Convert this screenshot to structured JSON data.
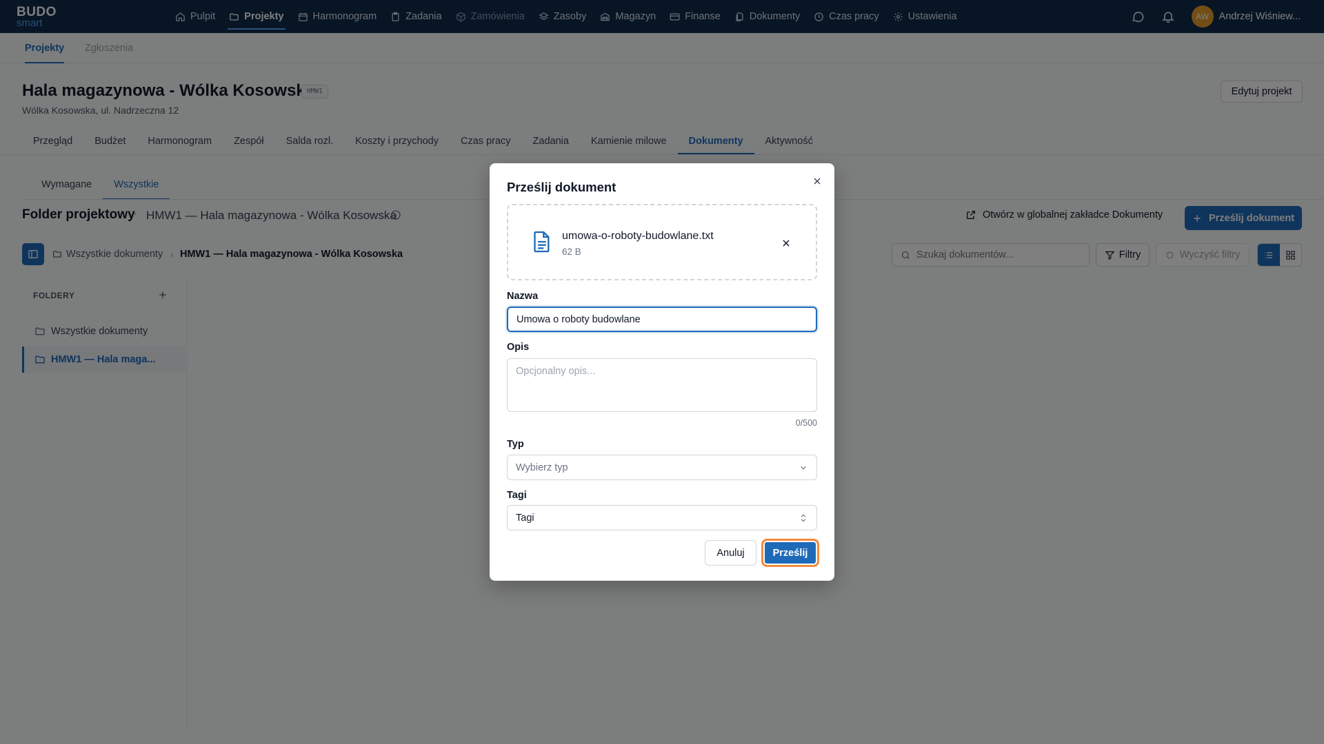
{
  "app": {
    "logo_line1": "BUDO",
    "logo_line2": "smart"
  },
  "nav": {
    "items": [
      {
        "label": "Pulpit",
        "icon": "home-icon"
      },
      {
        "label": "Projekty",
        "icon": "folder-icon"
      },
      {
        "label": "Harmonogram",
        "icon": "calendar-icon"
      },
      {
        "label": "Zadania",
        "icon": "clipboard-icon"
      },
      {
        "label": "Zamówienia",
        "icon": "package-icon"
      },
      {
        "label": "Zasoby",
        "icon": "layers-icon"
      },
      {
        "label": "Magazyn",
        "icon": "warehouse-icon"
      },
      {
        "label": "Finanse",
        "icon": "credit-card-icon"
      },
      {
        "label": "Dokumenty",
        "icon": "files-icon"
      },
      {
        "label": "Czas pracy",
        "icon": "clock-icon"
      },
      {
        "label": "Ustawienia",
        "icon": "gear-icon"
      }
    ],
    "user": {
      "initials": "AW",
      "name": "Andrzej Wiśniew..."
    }
  },
  "subnav": {
    "tabs": [
      "Projekty",
      "Zgłoszenia"
    ]
  },
  "project": {
    "title": "Hala magazynowa - Wólka Kosowska",
    "code": "HMW1",
    "address": "Wólka Kosowska, ul. Nadrzeczna 12",
    "edit_label": "Edytuj projekt",
    "tabs": [
      "Przegląd",
      "Budżet",
      "Harmonogram",
      "Zespół",
      "Salda rozl.",
      "Koszty i przychody",
      "Czas pracy",
      "Zadania",
      "Kamienie milowe",
      "Dokumenty",
      "Aktywność"
    ]
  },
  "documents": {
    "tabs": [
      "Wymagane",
      "Wszystkie"
    ],
    "folder_title": "Folder projektowy",
    "folder_dot": "·",
    "folder_subtitle": "HMW1 — Hala magazynowa - Wólka Kosowska",
    "open_global_label": "Otwórz w globalnej zakładce Dokumenty",
    "upload_label": "Prześlij dokument",
    "breadcrumb_root": "Wszystkie dokumenty",
    "breadcrumb_current": "HMW1 — Hala magazynowa - Wólka Kosowska",
    "search_placeholder": "Szukaj dokumentów...",
    "filters_label": "Filtry",
    "clear_filters_label": "Wyczyść filtry",
    "folders_heading": "FOLDERY",
    "folders": [
      "Wszystkie dokumenty",
      "HMW1 — Hala maga..."
    ]
  },
  "modal": {
    "title": "Prześlij dokument",
    "file_name": "umowa-o-roboty-budowlane.txt",
    "file_size": "62 B",
    "name_label": "Nazwa",
    "name_value": "Umowa o roboty budowlane",
    "description_label": "Opis",
    "description_placeholder": "Opcjonalny opis...",
    "description_counter": "0/500",
    "type_label": "Typ",
    "type_placeholder": "Wybierz typ",
    "tags_label": "Tagi",
    "tags_value": "Tagi",
    "cancel_label": "Anuluj",
    "submit_label": "Prześlij"
  },
  "colors": {
    "nav_bg": "#0f2a4a",
    "accent": "#1e6ab8",
    "focus_ring": "#f28b3a",
    "avatar": "#e59a2b"
  }
}
